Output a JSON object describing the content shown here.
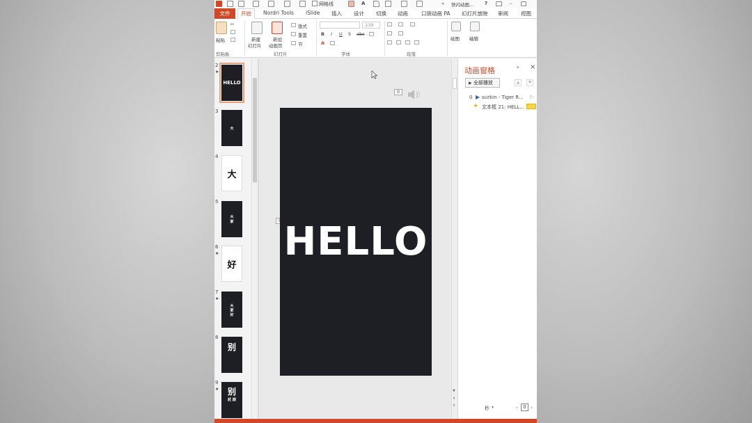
{
  "quick_access": {
    "gridlines_label": "网格线",
    "window_title": "快闪动画...",
    "help": "?"
  },
  "tabs": [
    {
      "label": "文件"
    },
    {
      "label": "开始"
    },
    {
      "label": "Nordri Tools"
    },
    {
      "label": "iSlide"
    },
    {
      "label": "插入"
    },
    {
      "label": "设计"
    },
    {
      "label": "切换"
    },
    {
      "label": "动画"
    },
    {
      "label": "口袋动画 PA"
    },
    {
      "label": "幻灯片放映"
    },
    {
      "label": "审阅"
    },
    {
      "label": "视图"
    }
  ],
  "ribbon": {
    "paste": "粘贴",
    "clipboard": "剪贴板",
    "new_slide_l1": "新建",
    "new_slide_l2": "幻灯片",
    "new_anim_l1": "新加",
    "new_anim_l2": "动画页",
    "layout": "版式",
    "reset": "重置",
    "section": "节",
    "slides_group": "幻灯片",
    "font_size": "239",
    "font_group": "字体",
    "paragraph_group": "段落",
    "drawing": "绘图",
    "editing": "编辑"
  },
  "thumbnails": [
    {
      "num": "2",
      "star": "★",
      "text": "HELLO",
      "sub": "",
      "style": "dark-selected"
    },
    {
      "num": "3",
      "star": "",
      "text": "大",
      "sub": "",
      "style": "dark-tiny"
    },
    {
      "num": "4",
      "star": "",
      "text": "大",
      "sub": "",
      "style": "white"
    },
    {
      "num": "5",
      "star": "",
      "text": "大",
      "sub": "家",
      "style": "dark-tiny"
    },
    {
      "num": "6",
      "star": "★",
      "text": "好",
      "sub": "",
      "style": "white"
    },
    {
      "num": "7",
      "star": "★",
      "text": "大",
      "sub": "家 好",
      "style": "dark-tiny"
    },
    {
      "num": "8",
      "star": "",
      "text": "别",
      "sub": "",
      "style": "dark"
    },
    {
      "num": "9",
      "star": "★",
      "text": "别",
      "sub": "赶 期",
      "style": "dark"
    }
  ],
  "slide": {
    "text": "HELLO",
    "marker_top": "0",
    "marker_left": "0"
  },
  "animation_pane": {
    "title": "动画窗格",
    "close": "×",
    "play_all": "全部播放",
    "items": [
      {
        "index": "0",
        "label": "surkin - Tiger R..."
      },
      {
        "index": "",
        "label": "文本框 21: HELL..."
      }
    ],
    "seconds": "秒",
    "zoom_box": "0"
  },
  "colors": {
    "accent": "#d24726",
    "slide_bg": "#1e1f25",
    "selected_outline": "#e9a07d"
  }
}
